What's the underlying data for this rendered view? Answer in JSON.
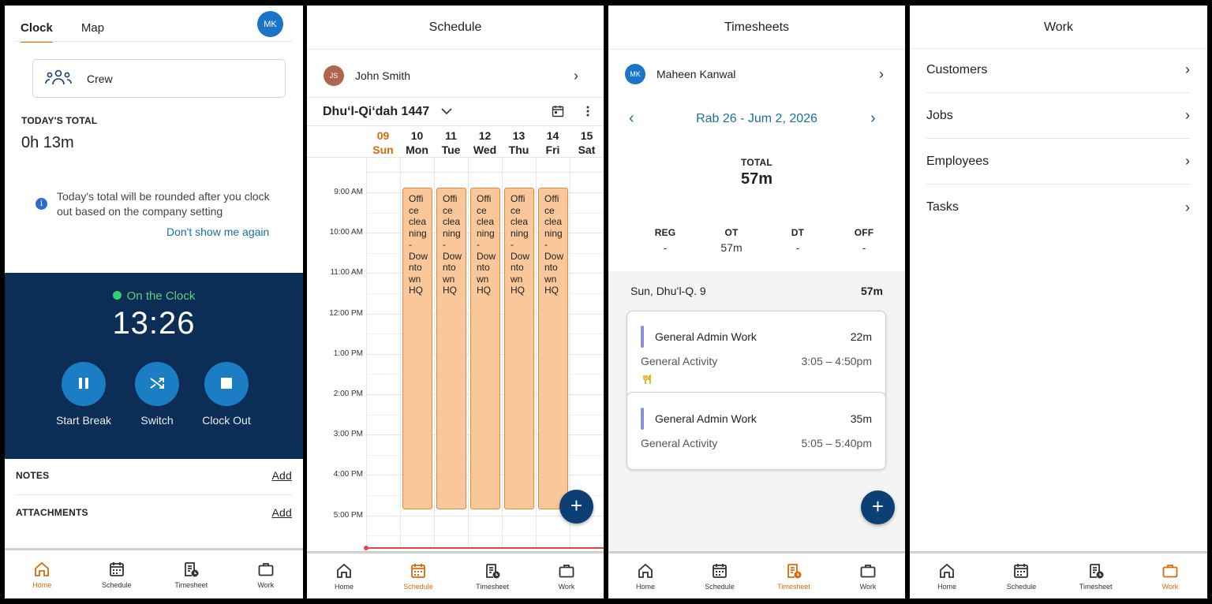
{
  "colors": {
    "accent_orange": "#d96a0c",
    "navy": "#0c2d55",
    "blue_button": "#1b7ec4",
    "event_fill": "#f9c79a",
    "link": "#1a6fa0",
    "on_clock_dot": "#2fd26a"
  },
  "tabbar": {
    "home": "Home",
    "schedule": "Schedule",
    "timesheet": "Timesheet",
    "work": "Work"
  },
  "clock_screen": {
    "tabs": [
      "Clock",
      "Map"
    ],
    "avatar": "MK",
    "crew_label": "Crew",
    "todays_total_label": "TODAY'S TOTAL",
    "todays_total_value": "0h 13m",
    "info_text": "Today's total will be rounded after you clock out based on the company setting",
    "dont_show": "Don't show me again",
    "status": "On the Clock",
    "time": "13:26",
    "buttons": [
      "Start Break",
      "Switch",
      "Clock Out"
    ],
    "notes_label": "NOTES",
    "attachments_label": "ATTACHMENTS",
    "add_label": "Add"
  },
  "schedule_screen": {
    "title": "Schedule",
    "employee_initials": "JS",
    "employee_name": "John Smith",
    "month": "Dhuʻl-Qiʻdah 1447",
    "days": [
      {
        "num": "09",
        "name": "Sun",
        "today": true
      },
      {
        "num": "10",
        "name": "Mon"
      },
      {
        "num": "11",
        "name": "Tue"
      },
      {
        "num": "12",
        "name": "Wed"
      },
      {
        "num": "13",
        "name": "Thu"
      },
      {
        "num": "14",
        "name": "Fri"
      },
      {
        "num": "15",
        "name": "Sat"
      }
    ],
    "hours": [
      "9:00 AM",
      "10:00 AM",
      "11:00 AM",
      "12:00 PM",
      "1:00 PM",
      "2:00 PM",
      "3:00 PM",
      "4:00 PM",
      "5:00 PM"
    ],
    "event_text": "Office cleaning - Downtown HQ",
    "event_text_wrapped": [
      "Offi",
      "ce",
      "clea",
      "ning",
      "-",
      "Dow",
      "nto",
      "wn",
      "HQ"
    ],
    "fab": "+"
  },
  "timesheets_screen": {
    "title": "Timesheets",
    "employee_initials": "MK",
    "employee_name": "Maheen Kanwal",
    "range": "Rab 26 - Jum 2, 2026",
    "total_label": "TOTAL",
    "total_value": "57m",
    "breakdown": [
      {
        "label": "REG",
        "value": "-"
      },
      {
        "label": "OT",
        "value": "57m"
      },
      {
        "label": "DT",
        "value": "-"
      },
      {
        "label": "OFF",
        "value": "-"
      }
    ],
    "day_label": "Sun, Dhuʻl-Q. 9",
    "day_total": "57m",
    "entries": [
      {
        "title": "General Admin Work",
        "duration": "22m",
        "activity": "General Activity",
        "time": "3:05 – 4:50pm"
      },
      {
        "title": "General Admin Work",
        "duration": "35m",
        "activity": "General Activity",
        "time": "5:05 – 5:40pm"
      }
    ],
    "fab": "+"
  },
  "work_screen": {
    "title": "Work",
    "items": [
      "Customers",
      "Jobs",
      "Employees",
      "Tasks"
    ]
  }
}
